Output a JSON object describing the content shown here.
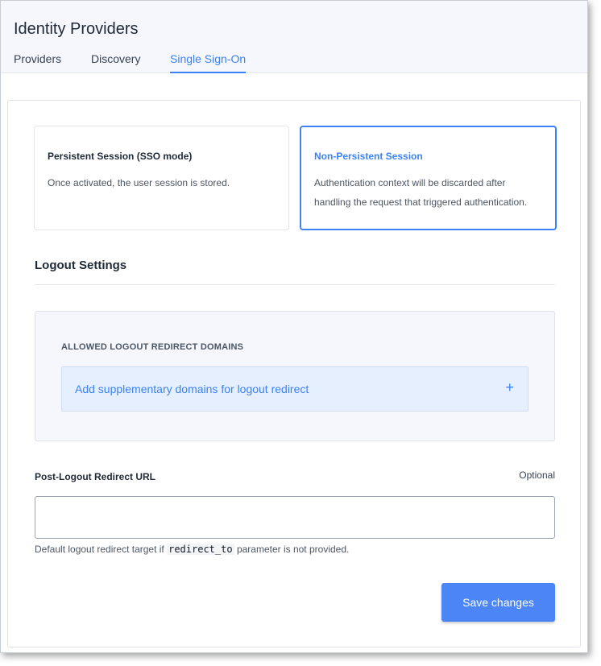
{
  "header": {
    "title": "Identity Providers",
    "tabs": [
      {
        "label": "Providers"
      },
      {
        "label": "Discovery"
      },
      {
        "label": "Single Sign-On",
        "active": true
      }
    ]
  },
  "session_options": [
    {
      "title": "Persistent Session (SSO mode)",
      "description": "Once activated, the user session is stored.",
      "selected": false
    },
    {
      "title": "Non-Persistent Session",
      "description": "Authentication context will be discarded after handling the request that triggered authentication.",
      "selected": true
    }
  ],
  "logout": {
    "section_title": "Logout Settings",
    "domains_label": "ALLOWED LOGOUT REDIRECT DOMAINS",
    "add_domain_text": "Add supplementary domains for logout redirect",
    "add_icon": "plus-icon",
    "redirect_url": {
      "label": "Post-Logout Redirect URL",
      "optional_label": "Optional",
      "value": "",
      "help_prefix": "Default logout redirect target if",
      "help_code": "redirect_to",
      "help_suffix": "parameter is not provided."
    }
  },
  "actions": {
    "save_label": "Save changes"
  },
  "colors": {
    "accent": "#3b82f6",
    "header_bg": "#f5f7fc",
    "button_bg": "#4c85f6"
  }
}
